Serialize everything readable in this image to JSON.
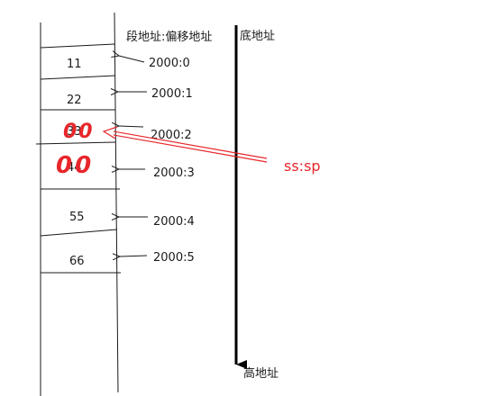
{
  "header": {
    "segment_offset_label": "段地址:偏移地址",
    "low_address_label": "底地址",
    "high_address_label": "高地址"
  },
  "cells": [
    {
      "value": "11",
      "address": "2000:0"
    },
    {
      "value": "22",
      "address": "2000:1"
    },
    {
      "value": "33",
      "address": "2000:2",
      "overwritten": "00"
    },
    {
      "value": "44",
      "address": "2000:3",
      "overwritten": "00"
    },
    {
      "value": "55",
      "address": "2000:4"
    },
    {
      "value": "66",
      "address": "2000:5"
    }
  ],
  "pointer": {
    "label": "ss:sp",
    "target_address": "2000:2"
  },
  "colors": {
    "ink": "#1a1a1a",
    "annotation": "#e8262b"
  }
}
